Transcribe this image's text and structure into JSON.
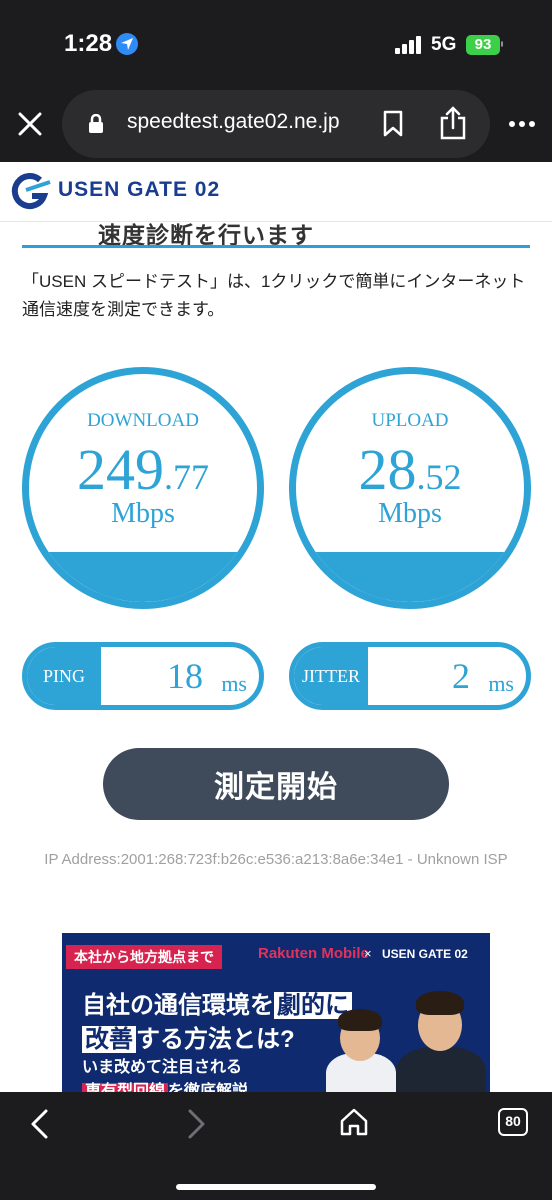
{
  "status_bar": {
    "time": "1:28",
    "network": "5G",
    "battery": "93"
  },
  "browser": {
    "url": "speedtest.gate02.ne.jp",
    "tab_count": "80"
  },
  "site": {
    "logo_text": "USEN GATE 02"
  },
  "page": {
    "heading": "速度診断を行います",
    "intro": "「USEN スピードテスト」は、1クリックで簡単にインターネット通信速度を測定できます。"
  },
  "download": {
    "label": "DOWNLOAD",
    "int": "249",
    "dec": ".77",
    "unit": "Mbps"
  },
  "upload": {
    "label": "UPLOAD",
    "int": "28",
    "dec": ".52",
    "unit": "Mbps"
  },
  "ping": {
    "label": "PING",
    "value": "18",
    "unit": "ms"
  },
  "jitter": {
    "label": "JITTER",
    "value": "2",
    "unit": "ms"
  },
  "start_button": "測定開始",
  "ip_text": "IP Address:2001:268:723f:b26c:e536:a213:8a6e:34e1 - Unknown ISP",
  "ad": {
    "tag": "本社から地方拠点まで",
    "brand1": "Rakuten Mobile",
    "x": "×",
    "brand2": "USEN GATE 02",
    "line1_a": "自社の通信環境を",
    "line1_hl": "劇的に",
    "line2_hl": "改善",
    "line2_b": "する方法とは?",
    "sub1": "いま改めて注目される",
    "sub2_hl": "専有型回線",
    "sub2_b": "を徹底解説"
  },
  "colors": {
    "accent": "#2ea3d6",
    "button": "#3f4b5b",
    "ad_bg": "#0f2a6e"
  }
}
